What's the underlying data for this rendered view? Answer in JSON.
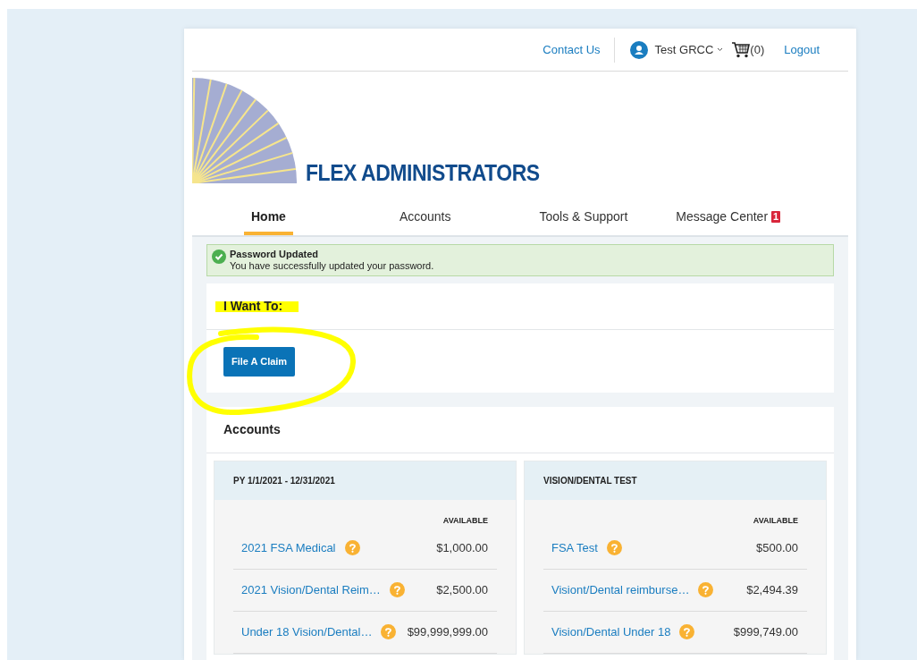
{
  "top_bar": {
    "contact": "Contact Us",
    "user": "Test GRCC",
    "cart": "(0)",
    "logout": "Logout"
  },
  "logo": {
    "text": "FLEX ADMINISTRATORS"
  },
  "tabs": [
    {
      "label": "Home",
      "selected": true
    },
    {
      "label": "Accounts",
      "selected": false
    },
    {
      "label": "Tools & Support",
      "selected": false
    },
    {
      "label": "Message Center",
      "selected": false,
      "badge": "1"
    }
  ],
  "alert": {
    "title": "Password Updated",
    "message": "You have successfully updated your password."
  },
  "i_want_to": {
    "title": "I Want To:",
    "buttons": [
      "File A Claim"
    ]
  },
  "accounts": {
    "title": "Accounts",
    "groups": [
      {
        "title": "PY 1/1/2021 - 12/31/2021",
        "column": "AVAILABLE",
        "rows": [
          {
            "name": "2021 FSA Medical",
            "amount": "$1,000.00"
          },
          {
            "name": "2021 Vision/Dental Reim…",
            "amount": "$2,500.00"
          },
          {
            "name": "Under 18 Vision/Dental…",
            "amount": "$99,999,999.00"
          }
        ]
      },
      {
        "title": "VISION/DENTAL TEST",
        "column": "AVAILABLE",
        "rows": [
          {
            "name": "FSA Test",
            "amount": "$500.00"
          },
          {
            "name": "Visiont/Dental reimburse…",
            "amount": "$2,494.39"
          },
          {
            "name": "Vision/Dental Under 18",
            "amount": "$999,749.00"
          }
        ]
      }
    ]
  }
}
